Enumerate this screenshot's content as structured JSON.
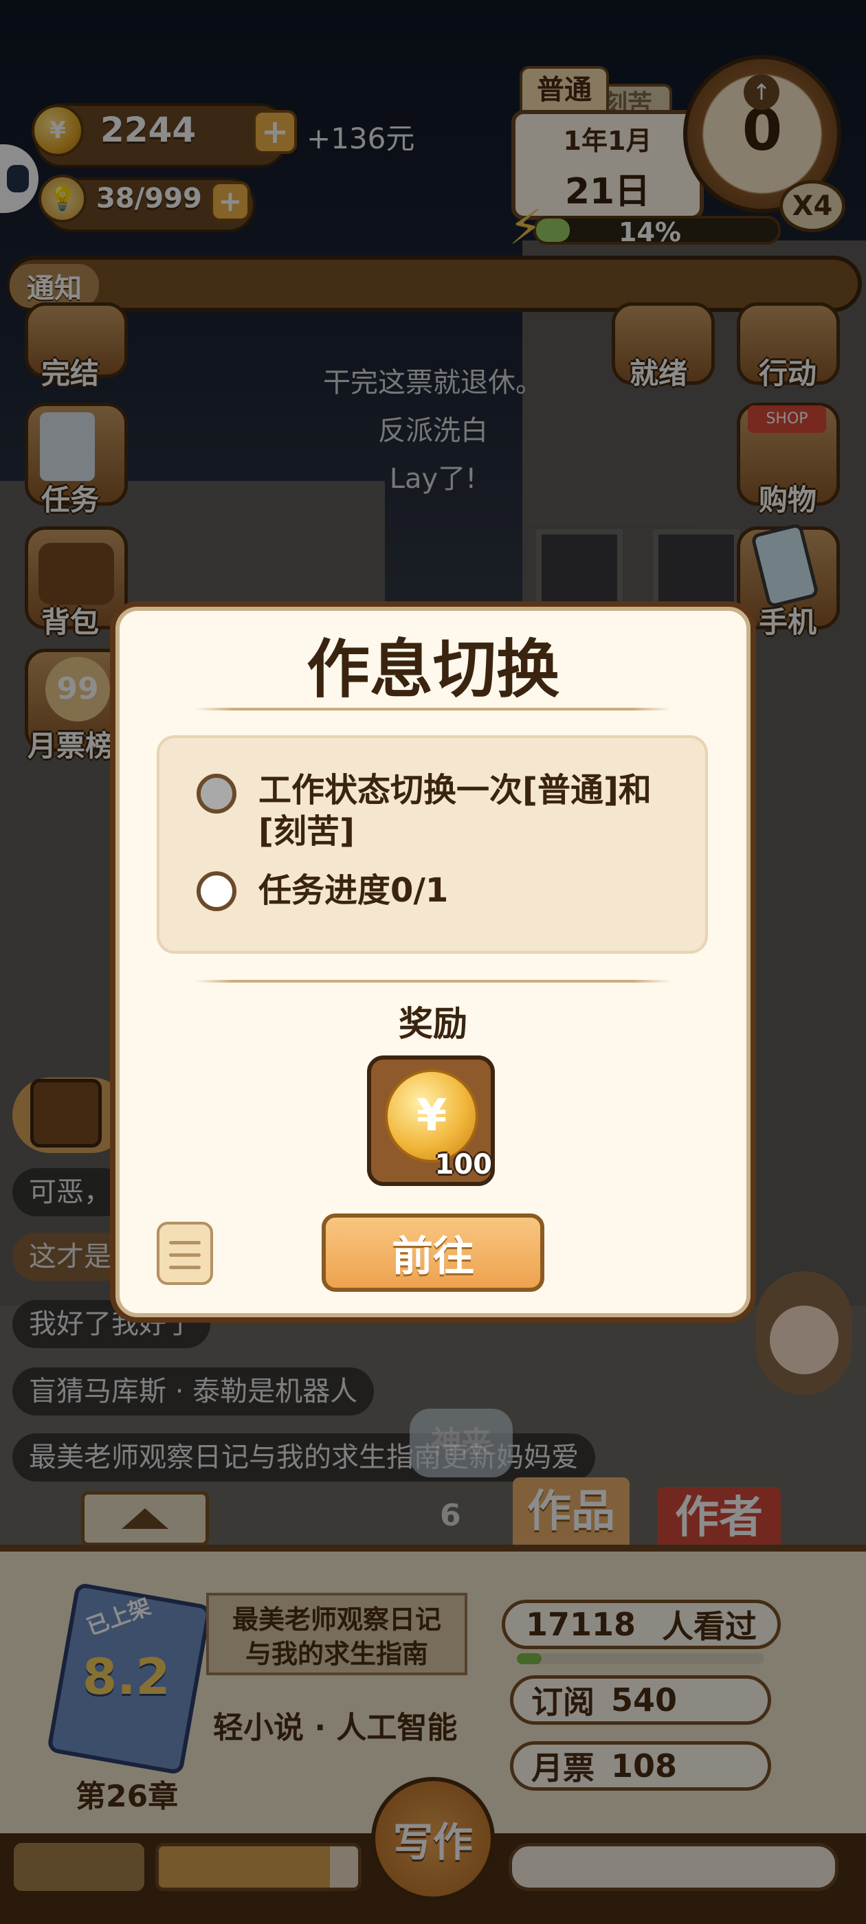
{
  "hud": {
    "coins": "2244",
    "coins_income": "+136元",
    "energy": "38/999",
    "mode_tab_active": "普通",
    "mode_tab_other": "刻苦",
    "date_year_month": "1年1月",
    "date_day": "21日",
    "progress_percent": "14%",
    "clock_value": "0",
    "speed": "X4",
    "notice_tag": "通知"
  },
  "side_left": [
    "完结",
    "任务",
    "背包",
    "月票榜"
  ],
  "side_right": [
    "就绪",
    "行动",
    "购物",
    "手机"
  ],
  "float_texts": [
    "干完这票就退休。",
    "反派洗白",
    "Lay了!"
  ],
  "chats": [
    "可恶，",
    "这才是",
    "我好了我好了",
    "盲猜马库斯 · 泰勒是机器人",
    "最美老师观察日记与我的求生指南更新妈妈爱"
  ],
  "modal": {
    "title": "作息切换",
    "tasks": [
      {
        "text": "工作状态切换一次[普通]和[刻苦]",
        "done": true
      },
      {
        "text": "任务进度0/1",
        "done": false
      }
    ],
    "reward_label": "奖励",
    "reward_count": "100",
    "go_label": "前往"
  },
  "tabs": {
    "works": "作品",
    "author": "作者",
    "badge_count": "6",
    "shen_lai": "神来"
  },
  "book": {
    "status_tag": "已上架",
    "score": "8.2",
    "title_line1": "最美老师观察日记",
    "title_line2": "与我的求生指南",
    "genre": "轻小说 · 人工智能",
    "chapter": "第26章",
    "views": "17118",
    "views_label": "人看过",
    "subscribe_label": "订阅",
    "subscribe_value": "540",
    "monthly_label": "月票",
    "monthly_value": "108",
    "views_progress": 0.1
  },
  "write_button": "写作"
}
